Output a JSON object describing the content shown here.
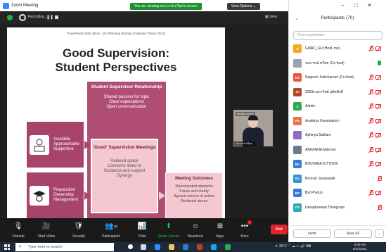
{
  "window": {
    "title": "Zoom Meeting"
  },
  "banner": {
    "text": "You are viewing จนการณ์ ทวีสุข's screen",
    "view_options": "View Options ⌄"
  },
  "topstrip": {
    "sharer_label": "Recording...",
    "view_label": "View"
  },
  "slide": {
    "subtitle": "PowerPoint Slide Show - [21 Planning Starting Graduate Thesis 2021]",
    "title_line1": "Good Supervision:",
    "title_line2": "Student Perspectives",
    "relationship_heading": "Student Supervisor Relationship",
    "relationship_points": [
      "Shared passion for topic",
      "Clear expectations",
      "Open communication"
    ],
    "meetings_heading": "'Good' Supervision Meetings",
    "meetings_points": [
      "Relaxed space",
      "Concerns listed to",
      "Guidance and support",
      "Synergy"
    ],
    "left_box1": [
      "Available",
      "Approachable",
      "Supportive"
    ],
    "left_box2": [
      "Preparation",
      "Ownership",
      "Management"
    ],
    "outcomes_heading": "Meeting Outcomes",
    "outcomes_points": [
      "Remotivated students",
      "Focus and clarity",
      "Agreed course of action",
      "Reduced stress"
    ]
  },
  "video": {
    "name": "จนการณ์ ทวีสุข...",
    "top_button": "Remote control"
  },
  "participants": {
    "title": "Participants (70)",
    "search_placeholder": "Find a participant",
    "list": [
      {
        "initials": "G",
        "name": "GMAC_SU (Host, me)",
        "color": "#f5a623",
        "state": "host"
      },
      {
        "initials": "",
        "name": "จนการณ์ ทวีสุข (Co-host)",
        "color": "#9aa4b0",
        "state": "cohost"
      },
      {
        "initials": "NS",
        "name": "Nopporn Sukcharoen (Co-host)",
        "color": "#e8563f",
        "state": "muted-nocam"
      },
      {
        "initials": "2e",
        "name": "2250e มหาวิทย์ อุทิศศักดิ์",
        "color": "#b3472c",
        "state": "muted-nocam"
      },
      {
        "initials": "A",
        "name": "Admin",
        "color": "#2fa84f",
        "state": "muted-nocam"
      },
      {
        "initials": "AK",
        "name": "Anattaya Kaewsakorn",
        "color": "#e8734a",
        "state": "muted-nocam"
      },
      {
        "initials": "",
        "name": "Aphinya Saiharn",
        "color": "#8e6cc0",
        "state": "muted-nocam"
      },
      {
        "initials": "",
        "name": "ARKANNA Makroat",
        "color": "#6a7b8c",
        "state": "muted-nocam"
      },
      {
        "initials": "BK",
        "name": "BHUVANA KITTOOK",
        "color": "#3b7bd6",
        "state": "muted-nocam"
      },
      {
        "initials": "BJ",
        "name": "Boonsit Jongsuksik",
        "color": "#3b8fd9",
        "state": "muted"
      },
      {
        "initials": "BP",
        "name": "But Phetun",
        "color": "#3b7bd6",
        "state": "muted-nocam"
      },
      {
        "initials": "DT",
        "name": "Daraphaswan Thongruan",
        "color": "#31a9b8",
        "state": "muted"
      }
    ],
    "invite_label": "Invite",
    "mute_all_label": "Mute All",
    "more_label": "..."
  },
  "toolbar": {
    "buttons": [
      {
        "label": "Unmute",
        "icon": "🎙"
      },
      {
        "label": "Start Video",
        "icon": "🎥"
      },
      {
        "label": "Security",
        "icon": "🛡"
      },
      {
        "label": "Participants",
        "icon": "👥"
      },
      {
        "label": "Polls",
        "icon": "📊"
      },
      {
        "label": "Share Screen",
        "icon": "⬆"
      },
      {
        "label": "Reactions",
        "icon": "☺"
      },
      {
        "label": "Apps",
        "icon": "⊞"
      },
      {
        "label": "More",
        "icon": "•••"
      }
    ],
    "participants_count": "70",
    "end_label": "End"
  },
  "taskbar": {
    "search_placeholder": "Type here to search",
    "weather": "36°C",
    "time": "9:09 AM",
    "date": "8/23/2021"
  }
}
